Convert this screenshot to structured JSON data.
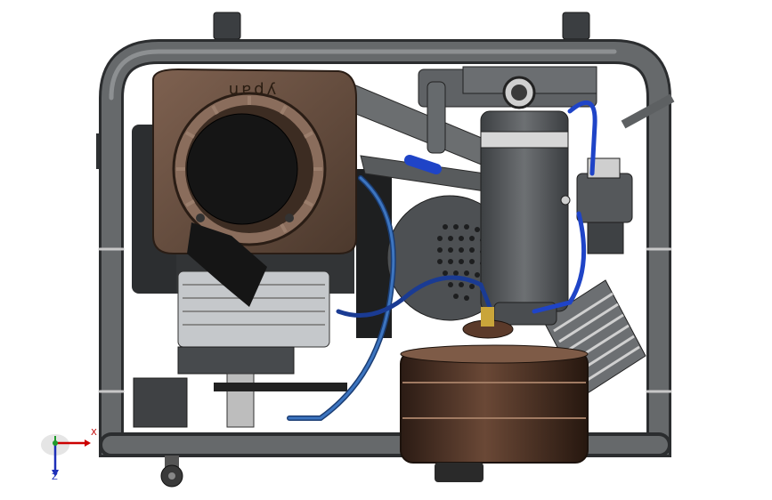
{
  "viewport": {
    "background": "#ffffff",
    "engine_brand_text": "ypan",
    "colors": {
      "frame": "#5e6163",
      "engine_cover": "#6f5546",
      "tank": "#4a3024",
      "hose": "#2f63a8",
      "body": "#595c5f"
    }
  },
  "triad": {
    "x_label": "X",
    "z_label": "Z",
    "x_color": "#cc0000",
    "y_color": "#1f9a2b",
    "z_color": "#1d2fb8"
  }
}
